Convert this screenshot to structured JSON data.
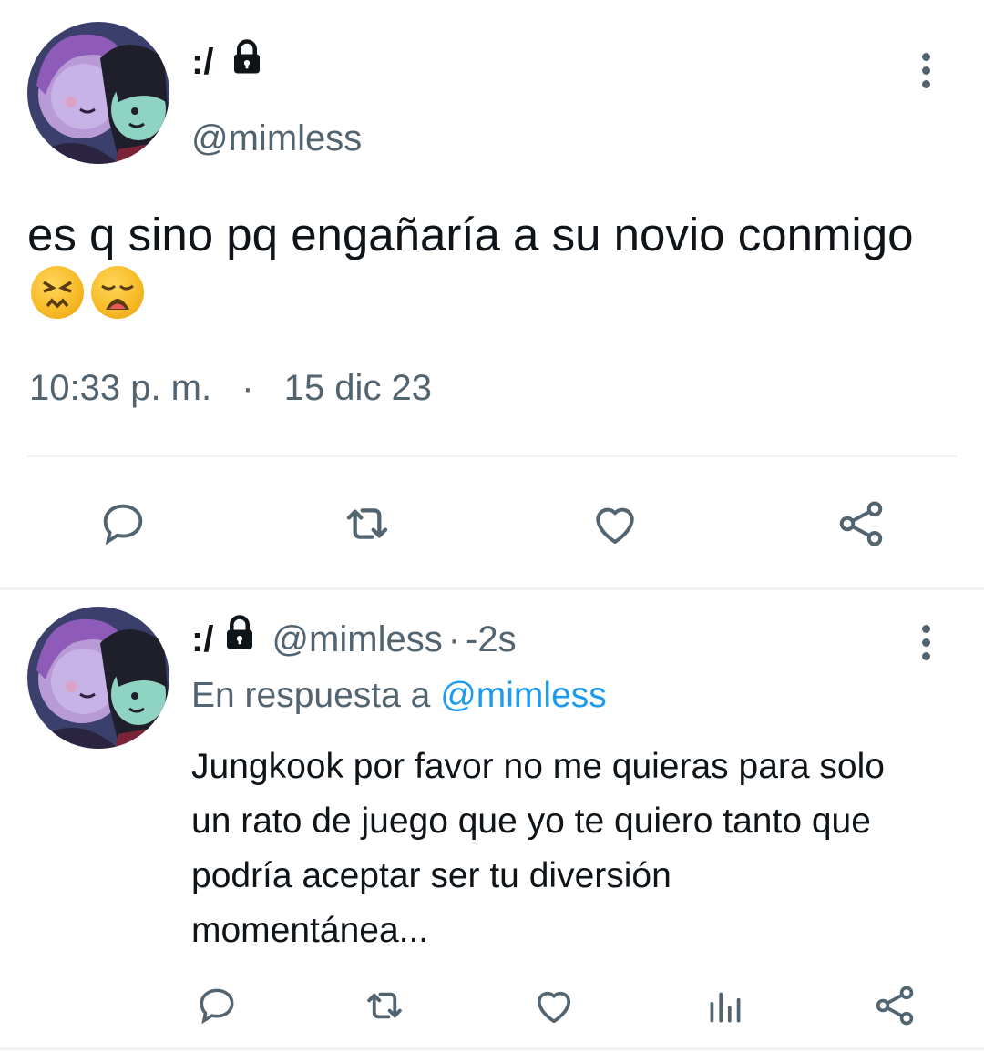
{
  "tweet": {
    "display_name": ":/",
    "handle": "@mimless",
    "text": "es q sino pq engañaría a su novio conmigo",
    "emojis": [
      "confounded-face",
      "weary-face"
    ],
    "time": "10:33 p. m.",
    "separator": "·",
    "date": "15 dic 23",
    "actions": [
      "reply-icon",
      "retweet-icon",
      "like-icon",
      "share-icon"
    ]
  },
  "reply": {
    "display_name": ":/",
    "handle": "@mimless",
    "separator": "·",
    "age": "-2s",
    "reply_prefix": "En respuesta a",
    "reply_to": "@mimless",
    "text_lines": [
      "Jungkook por favor no me quieras para solo",
      "un rato de juego que yo te quiero tanto que",
      "podría aceptar ser tu diversión",
      "momentánea..."
    ],
    "actions": [
      "reply-icon",
      "retweet-icon",
      "like-icon",
      "views-icon",
      "share-icon"
    ]
  },
  "colors": {
    "text": "#0f1419",
    "secondary": "#536471",
    "link": "#1d9bf0",
    "divider": "#eff3f4"
  }
}
